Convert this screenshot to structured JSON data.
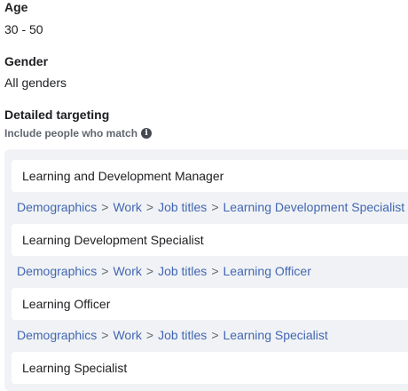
{
  "age": {
    "label": "Age",
    "value": "30 - 50"
  },
  "gender": {
    "label": "Gender",
    "value": "All genders"
  },
  "detailed_targeting": {
    "label": "Detailed targeting",
    "sub_label": "Include people who match",
    "info_icon": "info-icon",
    "items": [
      {
        "name": "Learning and Development Manager"
      },
      {
        "path": [
          "Demographics",
          "Work",
          "Job titles",
          "Learning Development Specialist"
        ]
      },
      {
        "name": "Learning Development Specialist"
      },
      {
        "path": [
          "Demographics",
          "Work",
          "Job titles",
          "Learning Officer"
        ]
      },
      {
        "name": "Learning Officer"
      },
      {
        "path": [
          "Demographics",
          "Work",
          "Job titles",
          "Learning Specialist"
        ]
      },
      {
        "name": "Learning Specialist"
      }
    ],
    "separator": ">"
  },
  "colors": {
    "link": "#4267b2",
    "panel_bg": "#f0f2f5",
    "text": "#1c1e21",
    "muted": "#606770"
  }
}
